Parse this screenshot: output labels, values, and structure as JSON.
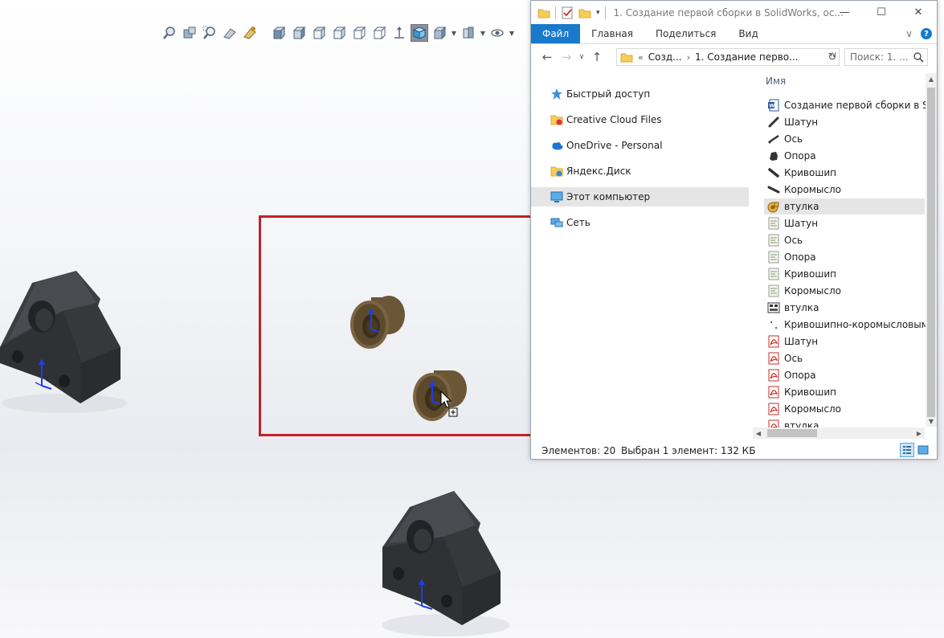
{
  "explorer": {
    "title": "1. Создание первой сборки в SolidWorks, ос...",
    "window_controls": {
      "minimize": "—",
      "maximize": "☐",
      "close": "✕"
    },
    "ribbon": {
      "tabs": [
        "Файл",
        "Главная",
        "Поделиться",
        "Вид"
      ],
      "expand_glyph": "∨",
      "help_glyph": "?"
    },
    "address": {
      "overflow": "«",
      "crumbs": [
        "Созд...",
        "1. Создание перво..."
      ],
      "search_placeholder": "Поиск: 1. ..."
    },
    "nav_items": [
      {
        "label": "Быстрый доступ",
        "icon": "star-icon"
      },
      {
        "label": "Creative Cloud Files",
        "icon": "creative-cloud-folder-icon"
      },
      {
        "label": "OneDrive - Personal",
        "icon": "onedrive-cloud-icon"
      },
      {
        "label": "Яндекс.Диск",
        "icon": "yandex-disk-folder-icon"
      },
      {
        "label": "Этот компьютер",
        "icon": "computer-icon",
        "selected": true
      },
      {
        "label": "Сеть",
        "icon": "network-icon"
      }
    ],
    "column_header": "Имя",
    "files": [
      {
        "name": "Создание первой сборки в Solid",
        "icon": "word-doc-icon"
      },
      {
        "name": "Шатун",
        "icon": "part-link-icon"
      },
      {
        "name": "Ось",
        "icon": "part-axis-icon"
      },
      {
        "name": "Опора",
        "icon": "part-support-icon"
      },
      {
        "name": "Кривошип",
        "icon": "part-crank-icon"
      },
      {
        "name": "Коромысло",
        "icon": "part-rocker-icon"
      },
      {
        "name": "втулка",
        "icon": "part-bushing-icon",
        "selected": true
      },
      {
        "name": "Шатун",
        "icon": "drawing-icon"
      },
      {
        "name": "Ось",
        "icon": "drawing-icon"
      },
      {
        "name": "Опора",
        "icon": "drawing-icon"
      },
      {
        "name": "Кривошип",
        "icon": "drawing-icon"
      },
      {
        "name": "Коромысло",
        "icon": "drawing-icon"
      },
      {
        "name": "втулка",
        "icon": "drawing-sheet-icon"
      },
      {
        "name": "Кривошипно-коромысловым м",
        "icon": "assembly-icon"
      },
      {
        "name": "Шатун",
        "icon": "pdf-icon"
      },
      {
        "name": "Ось",
        "icon": "pdf-icon"
      },
      {
        "name": "Опора",
        "icon": "pdf-icon"
      },
      {
        "name": "Кривошип",
        "icon": "pdf-icon"
      },
      {
        "name": "Коромысло",
        "icon": "pdf-icon"
      },
      {
        "name": "втулка",
        "icon": "pdf-icon"
      }
    ],
    "status": {
      "count": "Элементов: 20",
      "selection": "Выбран 1 элемент: 132 КБ"
    }
  },
  "solidworks": {
    "toolbar_icons": [
      "zoom-to-fit-icon",
      "zoom-to-area-icon",
      "zoom-in-out-icon",
      "pan-icon",
      "rotate-icon",
      "front-view-icon",
      "back-view-icon",
      "left-view-icon",
      "right-view-icon",
      "top-view-icon",
      "bottom-view-icon",
      "normal-to-icon",
      "isometric-view-icon",
      "display-style-icon",
      "section-view-icon",
      "hide-show-icon"
    ],
    "selection_color": "#c2202b",
    "part_color_dark": "#3a3b3f",
    "part_color_bronze": "#6e5a3a"
  },
  "colors": {
    "accent": "#1979ca",
    "selected_row": "#e5e5e5"
  }
}
